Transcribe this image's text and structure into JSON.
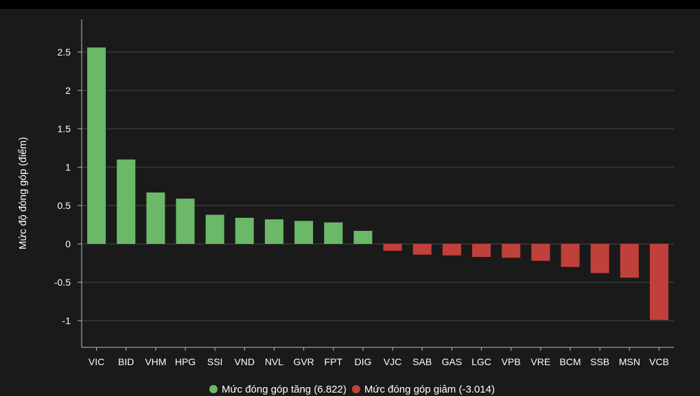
{
  "chart_data": {
    "type": "bar",
    "title": "",
    "xlabel": "",
    "ylabel": "Mức độ đóng góp (điểm)",
    "ylim": [
      -1.2,
      2.8
    ],
    "yticks": [
      -1,
      -0.5,
      0,
      0.5,
      1,
      1.5,
      2,
      2.5
    ],
    "ytick_labels": [
      "-1",
      "-0.5",
      "0",
      "0.5",
      "1",
      "1.5",
      "2",
      "2.5"
    ],
    "grid": true,
    "legend_position": "bottom-center",
    "categories": [
      "VIC",
      "BID",
      "VHM",
      "HPG",
      "SSI",
      "VND",
      "NVL",
      "GVR",
      "FPT",
      "DIG",
      "VJC",
      "SAB",
      "GAS",
      "LGC",
      "VPB",
      "VRE",
      "BCM",
      "SSB",
      "MSN",
      "VCB"
    ],
    "values": [
      2.56,
      1.1,
      0.67,
      0.59,
      0.38,
      0.34,
      0.32,
      0.3,
      0.28,
      0.17,
      -0.09,
      -0.14,
      -0.15,
      -0.17,
      -0.18,
      -0.22,
      -0.3,
      -0.38,
      -0.44,
      -0.99
    ],
    "colors": {
      "positive": "#6bb968",
      "negative": "#c0413b",
      "grid": "#4a4a4a",
      "axis": "#bfbfbf"
    },
    "legend": [
      {
        "label": "Mức đóng góp tăng (6.822)",
        "color": "#6bb968"
      },
      {
        "label": "Mức đóng góp giảm (-3.014)",
        "color": "#c0413b"
      }
    ]
  }
}
